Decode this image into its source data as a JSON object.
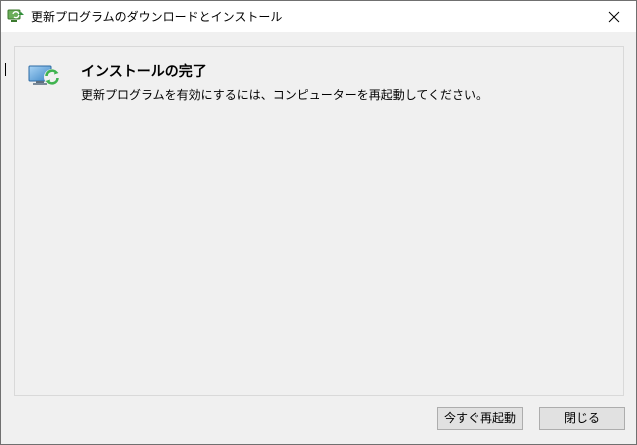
{
  "window": {
    "title": "更新プログラムのダウンロードとインストール",
    "app_icon": "windows-update-icon",
    "close_icon": "close-icon"
  },
  "content": {
    "status_icon": "update-complete-icon",
    "heading": "インストールの完了",
    "message": "更新プログラムを有効にするには、コンピューターを再起動してください。"
  },
  "buttons": {
    "restart_now": "今すぐ再起動",
    "close": "閉じる"
  },
  "colors": {
    "accent_green": "#3fb34f",
    "monitor_blue": "#5aa0d8"
  }
}
